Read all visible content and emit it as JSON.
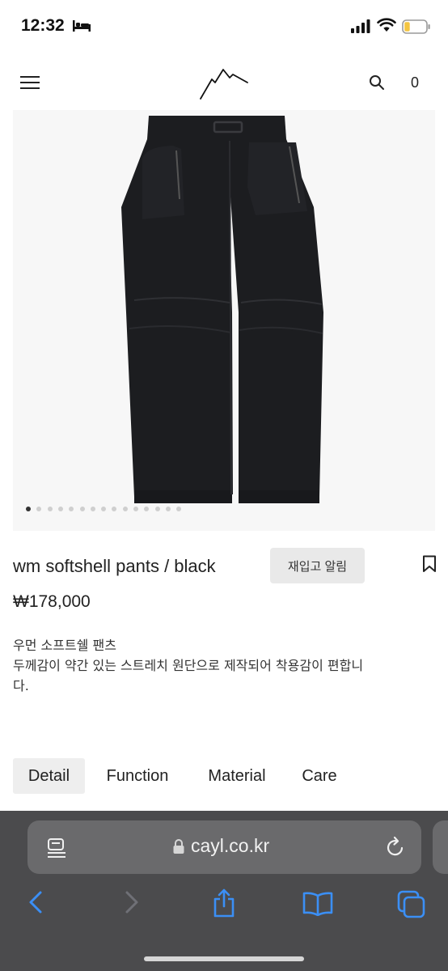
{
  "status_bar": {
    "time": "12:32"
  },
  "header": {
    "cart_count": "0"
  },
  "product": {
    "title": "wm softshell pants / black",
    "price": "₩178,000",
    "restock_label": "재입고 알림",
    "description_lines": [
      "우먼 소프트쉘 팬츠",
      "두께감이 약간 있는 스트레치 원단으로 제작되어 착용감이 편합니",
      "다."
    ],
    "image_count": 15,
    "active_image_index": 0
  },
  "tabs": [
    {
      "label": "Detail",
      "active": true
    },
    {
      "label": "Function",
      "active": false
    },
    {
      "label": "Material",
      "active": false
    },
    {
      "label": "Care",
      "active": false
    }
  ],
  "browser": {
    "url": "cayl.co.kr"
  },
  "colors": {
    "toolbar_bg": "#4b4b4d",
    "accent_blue": "#3b8ff5",
    "pants": "#1c1d20"
  },
  "icons": {
    "menu": "hamburger-menu-icon",
    "search": "search-icon",
    "bookmark": "bookmark-icon",
    "reader": "reader-mode-icon",
    "lock": "lock-icon",
    "reload": "reload-icon",
    "back": "back-chevron-icon",
    "forward": "forward-chevron-icon",
    "share": "share-icon",
    "bookmarks": "book-icon",
    "tabs": "tabs-icon"
  }
}
